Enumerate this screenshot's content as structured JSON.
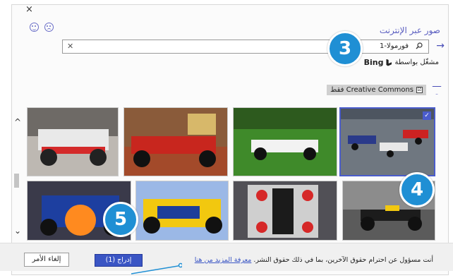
{
  "dialog": {
    "close": "×",
    "title": "صور عبر الإنترنت",
    "search": {
      "value": "فورمولا-1"
    },
    "bing_text": "مشغّل بواسطة",
    "bing_brand": "Bing",
    "filter_label": "Creative Commons فقط",
    "filter_check": "☑",
    "footer_note": "أنت مسؤول عن احترام حقوق الآخرين، بما في ذلك حقوق النشر.",
    "learn_more": "معرفة المزيد من هنا",
    "insert_label": "إدراج (1)",
    "cancel_label": "إلغاء الأمر"
  },
  "badges": {
    "three": "3",
    "four": "4",
    "five": "5"
  },
  "colors": {
    "accent": "#3a55c4",
    "badge": "#1f8fd4",
    "title": "#5a5ec0"
  },
  "icons": {
    "close": "close-icon",
    "search": "search-icon",
    "arrow": "arrow-right-icon",
    "filter": "funnel-icon"
  }
}
